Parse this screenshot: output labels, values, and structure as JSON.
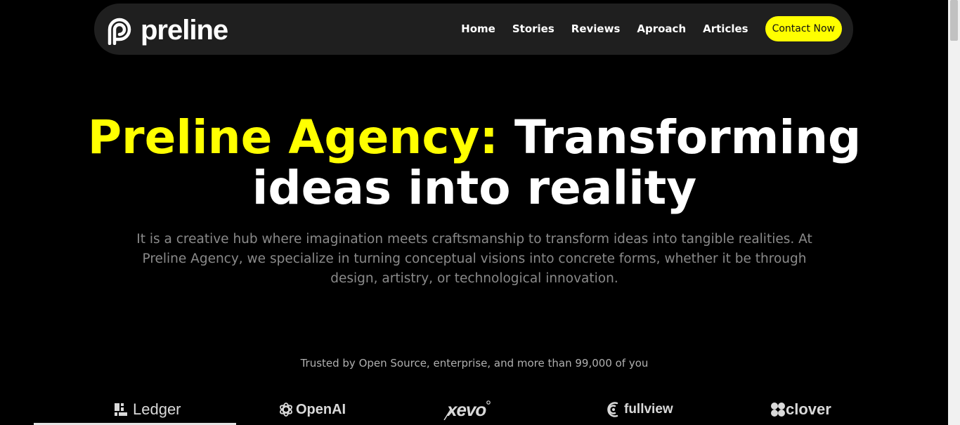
{
  "brand": {
    "name": "preline"
  },
  "nav": {
    "items": [
      {
        "label": "Home"
      },
      {
        "label": "Stories"
      },
      {
        "label": "Reviews"
      },
      {
        "label": "Aproach"
      },
      {
        "label": "Articles"
      }
    ],
    "cta_label": "Contact Now"
  },
  "hero": {
    "title_highlight": "Preline Agency:",
    "title_line1_rest": " Transforming",
    "title_line2": "ideas into reality",
    "description": "It is a creative hub where imagination meets craftsmanship to transform ideas into tangible realities. At Preline Agency, we specialize in turning conceptual visions into concrete forms, whether it be through design, artistry, or technological innovation."
  },
  "trusted_text": "Trusted by Open Source, enterprise, and more than 99,000 of you",
  "logos": [
    {
      "name": "Ledger",
      "icon": "ledger-icon"
    },
    {
      "name": "OpenAI",
      "icon": "openai-icon"
    },
    {
      "name": "xevo",
      "icon": "xevo-icon"
    },
    {
      "name": "fullview",
      "icon": "fullview-icon"
    },
    {
      "name": "clover",
      "icon": "clover-icon"
    }
  ],
  "colors": {
    "accent": "#ffff00",
    "background": "#000000",
    "nav_background": "#1f1f1f",
    "muted_text": "#8a8a8a"
  }
}
